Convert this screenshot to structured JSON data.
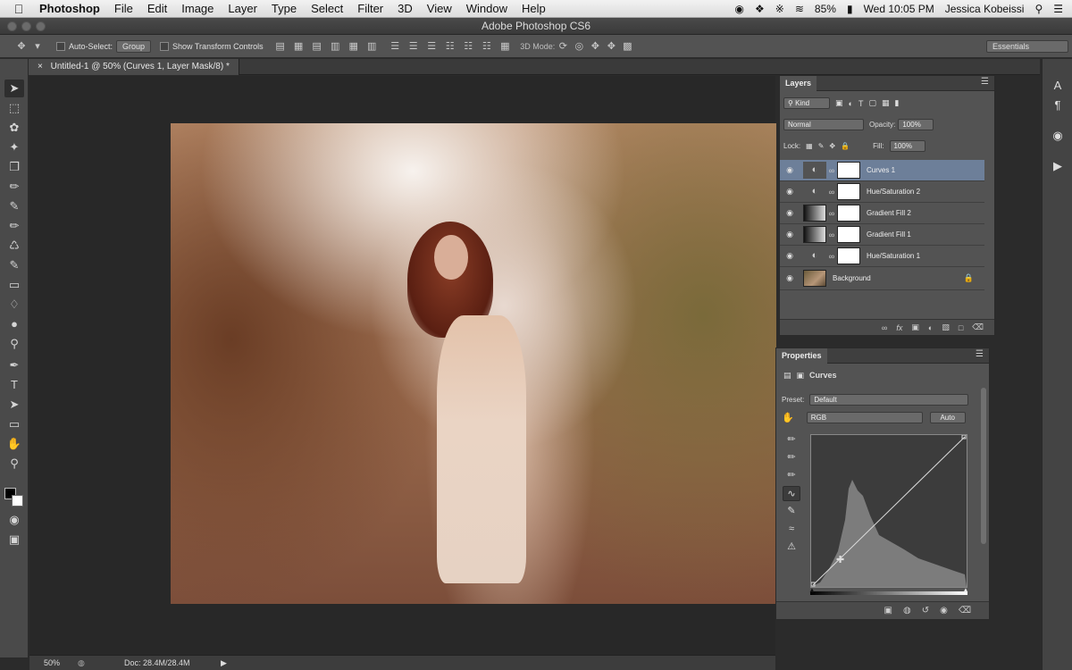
{
  "menubar": {
    "apple_icon": "apple-logo",
    "app_name": "Photoshop",
    "items": [
      "File",
      "Edit",
      "Image",
      "Layer",
      "Type",
      "Select",
      "Filter",
      "3D",
      "View",
      "Window",
      "Help"
    ],
    "battery": "85%",
    "clock": "Wed 10:05 PM",
    "user": "Jessica Kobeissi"
  },
  "window": {
    "title": "Adobe Photoshop CS6"
  },
  "options_bar": {
    "auto_select_label": "Auto-Select:",
    "auto_select_value": "Group",
    "show_transform_label": "Show Transform Controls",
    "mode_3d_label": "3D Mode:",
    "workspace": "Essentials"
  },
  "document": {
    "tab_title": "Untitled-1 @ 50% (Curves 1, Layer Mask/8) *",
    "zoom": "50%",
    "doc_size": "Doc: 28.4M/28.4M"
  },
  "layers_panel": {
    "tab": "Layers",
    "filter": "Kind",
    "blend_mode": "Normal",
    "opacity_label": "Opacity:",
    "opacity": "100%",
    "lock_label": "Lock:",
    "fill_label": "Fill:",
    "fill": "100%",
    "layers": [
      {
        "name": "Curves 1",
        "selected": true
      },
      {
        "name": "Hue/Saturation 2",
        "selected": false
      },
      {
        "name": "Gradient Fill 2",
        "selected": false
      },
      {
        "name": "Gradient Fill 1",
        "selected": false
      },
      {
        "name": "Hue/Saturation 1",
        "selected": false
      },
      {
        "name": "Background",
        "selected": false
      }
    ]
  },
  "properties_panel": {
    "tab": "Properties",
    "title": "Curves",
    "preset_label": "Preset:",
    "preset_value": "Default",
    "channel": "RGB",
    "auto_button": "Auto"
  },
  "colors": {
    "panel_bg": "#535353",
    "selected_layer": "#6d7f99",
    "canvas_bg": "#282828"
  }
}
